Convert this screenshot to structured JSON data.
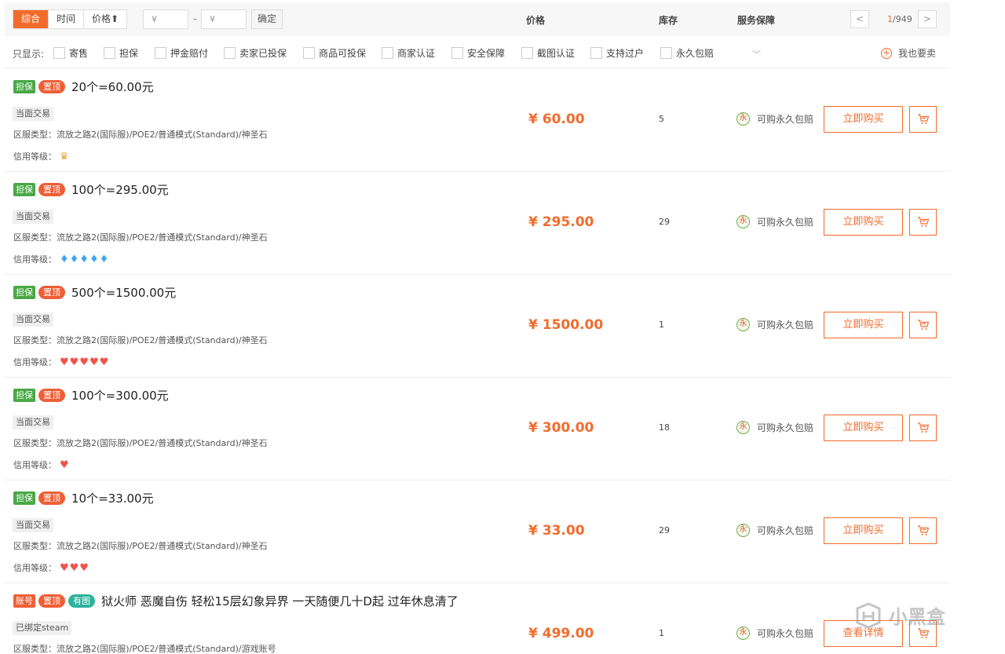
{
  "toolbar": {
    "sort_tabs": [
      "综合",
      "时间",
      "价格⬆"
    ],
    "min_price_placeholder": "¥",
    "max_price_placeholder": "¥",
    "dash": "-",
    "confirm": "确定",
    "col_price": "价格",
    "col_stock": "库存",
    "col_service": "服务保障",
    "pager_prev": "<",
    "pager_next": ">",
    "page_current": "1",
    "page_total": "/949"
  },
  "filter": {
    "label": "只显示:",
    "options": [
      "寄售",
      "担保",
      "押金赔付",
      "卖家已投保",
      "商品可投保",
      "商家认证",
      "安全保障",
      "截图认证",
      "支持过户",
      "永久包赔"
    ],
    "sell_label": "我也要卖"
  },
  "listings": [
    {
      "badges": [
        "担保",
        "置顶"
      ],
      "title": "20个=60.00元",
      "tag": "当面交易",
      "region": "区服类型：流放之路2(国际服)/POE2/普通模式(Standard)/神圣石",
      "credit_label": "信用等级：",
      "credit_icons": "♛",
      "price": "¥ 60.00",
      "stock": "5",
      "guarantee": "可购永久包赔",
      "action": "立即购买"
    },
    {
      "badges": [
        "担保",
        "置顶"
      ],
      "title": "100个=295.00元",
      "tag": "当面交易",
      "region": "区服类型：流放之路2(国际服)/POE2/普通模式(Standard)/神圣石",
      "credit_label": "信用等级：",
      "credit_icons": "♦♦♦♦♦",
      "price": "¥ 295.00",
      "stock": "29",
      "guarantee": "可购永久包赔",
      "action": "立即购买"
    },
    {
      "badges": [
        "担保",
        "置顶"
      ],
      "title": "500个=1500.00元",
      "tag": "当面交易",
      "region": "区服类型：流放之路2(国际服)/POE2/普通模式(Standard)/神圣石",
      "credit_label": "信用等级：",
      "credit_icons": "♥♥♥♥♥",
      "price": "¥ 1500.00",
      "stock": "1",
      "guarantee": "可购永久包赔",
      "action": "立即购买"
    },
    {
      "badges": [
        "担保",
        "置顶"
      ],
      "title": "100个=300.00元",
      "tag": "当面交易",
      "region": "区服类型：流放之路2(国际服)/POE2/普通模式(Standard)/神圣石",
      "credit_label": "信用等级：",
      "credit_icons": "♥",
      "price": "¥ 300.00",
      "stock": "18",
      "guarantee": "可购永久包赔",
      "action": "立即购买"
    },
    {
      "badges": [
        "担保",
        "置顶"
      ],
      "title": "10个=33.00元",
      "tag": "当面交易",
      "region": "区服类型：流放之路2(国际服)/POE2/普通模式(Standard)/神圣石",
      "credit_label": "信用等级：",
      "credit_icons": "♥♥♥",
      "price": "¥ 33.00",
      "stock": "29",
      "guarantee": "可购永久包赔",
      "action": "立即购买"
    },
    {
      "badges": [
        "账号",
        "置顶",
        "有图"
      ],
      "title": "狱火师 恶魔自伤 轻松15层幻象异界 一天随便几十D起 过年休息清了",
      "tag": "已绑定steam",
      "region": "区服类型：流放之路2(国际服)/POE2/普通模式(Standard)/游戏账号",
      "price": "¥ 499.00",
      "stock": "1",
      "guarantee": "可购永久包赔",
      "action": "查看详情"
    }
  ],
  "watermark": "小黑盒",
  "colors": {
    "accent": "#f26b2c",
    "badge_green": "#49a845",
    "badge_orange": "#ee5f36",
    "badge_teal": "#2db39b"
  }
}
